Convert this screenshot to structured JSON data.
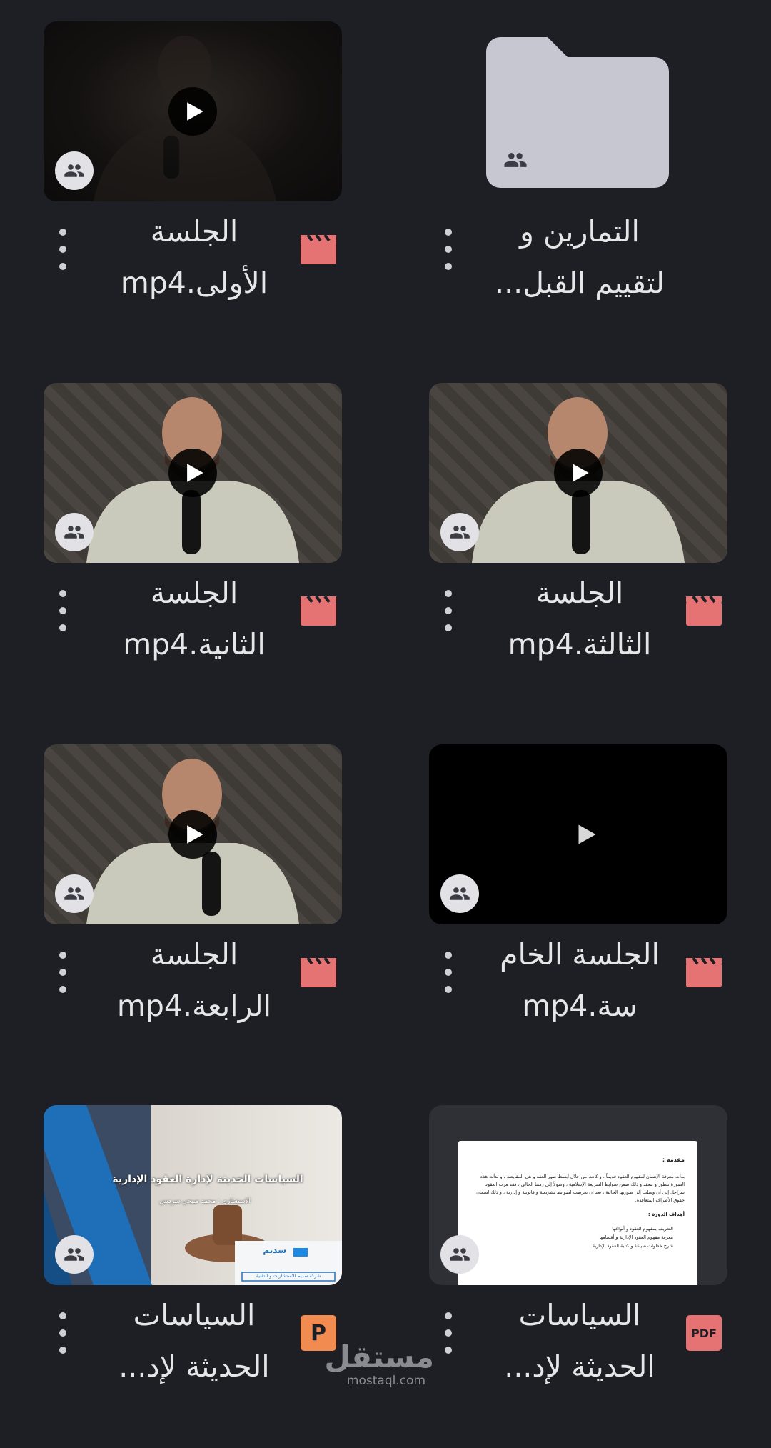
{
  "colors": {
    "background": "#1e1f24",
    "video_icon": "#e57373",
    "pdf_icon": "#e57373",
    "slides_icon": "#f28b50",
    "folder": "#c6c7d1"
  },
  "items": [
    {
      "kind": "folder",
      "line1": "التمارين و",
      "line2": "لتقييم القبل..."
    },
    {
      "kind": "video",
      "line1": "الجلسة",
      "line2": "الأولى.mp4"
    },
    {
      "kind": "video",
      "line1": "الجلسة",
      "line2": "الثالثة.mp4"
    },
    {
      "kind": "video",
      "line1": "الجلسة",
      "line2": "الثانية.mp4"
    },
    {
      "kind": "video",
      "line1": "الجلسة الخام",
      "line2": "سة.mp4"
    },
    {
      "kind": "video",
      "line1": "الجلسة",
      "line2": "الرابعة.mp4"
    },
    {
      "kind": "pdf",
      "line1": "السياسات",
      "line2": "الحديثة لإد...",
      "icon_label": "PDF"
    },
    {
      "kind": "slides",
      "line1": "السياسات",
      "line2": "الحديثة لإد...",
      "icon_label": "P"
    }
  ],
  "pdf_preview": {
    "heading": "مقدمة :",
    "paragraph": "بدأت معرفة الإنسان لمفهوم العقود قديماً ، و كانت من خلال أبسط صور العقد و هي المقايضة ، و بدأت هذه الصورة تتطور و تتعقد و ذلك ضمن ضوابط الشريعة الإسلامية ، وصولاً إلى زمننا الحالي ، فقد مرت العقود بمراحل إلى أن وصلت إلى صورتها الحالية ، بعد أن تعرضت لضوابط تشريعية و قانونية و إدارية ، و ذلك لضمان حقوق الأطراف المتعاقدة.",
    "goals_heading": "أهداف الدورة :",
    "goals": [
      "التعريف بمفهوم العقود و أنواعها",
      "معرفة مفهوم العقود الإدارية و أقسامها",
      "شرح خطوات صياغة و كتابة العقود الإدارية"
    ]
  },
  "slide_preview": {
    "title": "السياسات الحديثة لإدارة العقود الإدارية",
    "subtitle": "الاستشاري : محمد صبحي سرديني",
    "logo_name": "سديم",
    "logo_tagline": "شركة سديم للاستشارات و التقنية"
  },
  "watermark": {
    "arabic": "مستقل",
    "latin": "mostaql.com"
  }
}
